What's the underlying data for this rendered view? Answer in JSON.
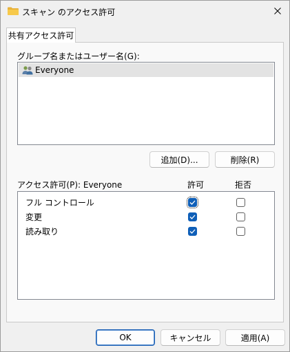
{
  "window": {
    "title": "スキャン のアクセス許可",
    "folder_color": "#e8b23a"
  },
  "tabs": [
    {
      "label": "共有アクセス許可",
      "selected": true
    }
  ],
  "groups": {
    "label": "グループ名またはユーザー名(G):",
    "items": [
      {
        "name": "Everyone",
        "icon": "users-icon",
        "selected": true
      }
    ],
    "add_label": "追加(D)...",
    "remove_label": "削除(R)"
  },
  "permissions": {
    "label": "アクセス許可(P): Everyone",
    "allow_header": "許可",
    "deny_header": "拒否",
    "rows": [
      {
        "name": "フル コントロール",
        "allow": true,
        "deny": false
      },
      {
        "name": "変更",
        "allow": true,
        "deny": false
      },
      {
        "name": "読み取り",
        "allow": true,
        "deny": false
      }
    ]
  },
  "footer": {
    "ok_label": "OK",
    "cancel_label": "キャンセル",
    "apply_label": "適用(A)"
  },
  "colors": {
    "accent": "#0f5fb8",
    "selection": "#e3e3e3"
  }
}
